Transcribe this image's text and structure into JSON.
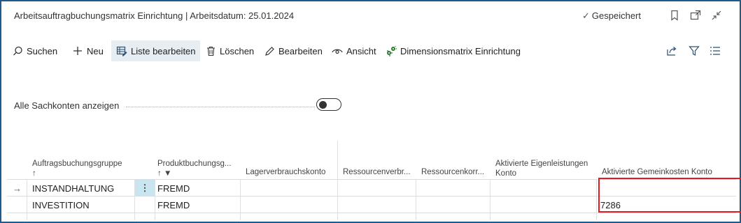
{
  "window": {
    "title": "Arbeitsauftragbuchungsmatrix Einrichtung | Arbeitsdatum: 25.01.2024",
    "saved_label": "Gespeichert"
  },
  "actions": {
    "search": "Suchen",
    "new": "Neu",
    "edit_list": "Liste bearbeiten",
    "delete": "Löschen",
    "edit": "Bearbeiten",
    "view": "Ansicht",
    "dimensions": "Dimensionsmatrix Einrichtung"
  },
  "filter": {
    "show_all_label": "Alle Sachkonten anzeigen",
    "show_all_value": false
  },
  "grid": {
    "columns": [
      {
        "label": "Auftragsbuchungsgruppe",
        "sub": "↑"
      },
      {
        "label": "Produktbuchungsg...",
        "sub": "↑ ▼"
      },
      {
        "label": "Lagerverbrauchskonto",
        "sub": ""
      },
      {
        "label": "Ressourcenverbr...",
        "sub": ""
      },
      {
        "label": "Ressourcenkorr...",
        "sub": ""
      },
      {
        "label": "Aktivierte Eigenleistungen Konto",
        "sub": ""
      },
      {
        "label": "Aktivierte Gemeinkosten Konto",
        "sub": ""
      }
    ],
    "rows": [
      {
        "marker": "→",
        "group": "INSTANDHALTUNG",
        "menu": "⋮",
        "product": "FREMD",
        "gemeinkosten": ""
      },
      {
        "marker": "",
        "group": "INVESTITION",
        "menu": "",
        "product": "FREMD",
        "gemeinkosten": "7286"
      }
    ]
  },
  "colors": {
    "frame": "#1f5a8a",
    "highlight": "#e01b24",
    "selected_row_menu": "#c9e6f0"
  }
}
